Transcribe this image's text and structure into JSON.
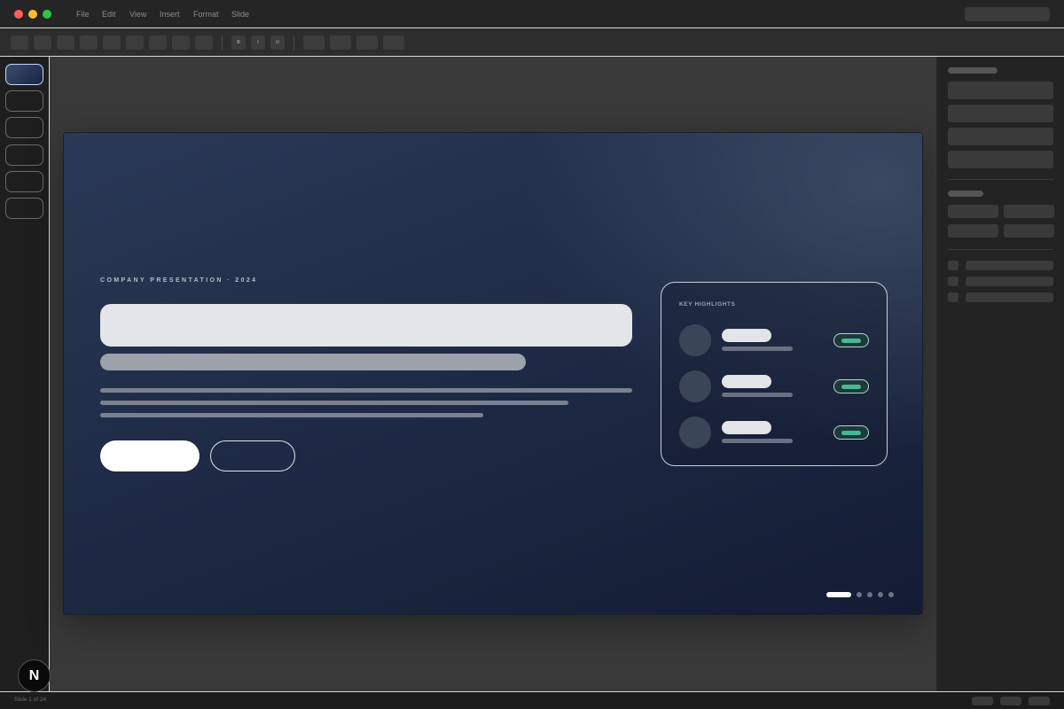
{
  "window": {
    "menu": [
      "File",
      "Edit",
      "View",
      "Insert",
      "Format",
      "Slide"
    ],
    "traffic_lights": {
      "close": "#ff5f57",
      "minimize": "#febc2e",
      "maximize": "#28c840"
    }
  },
  "toolbar": {
    "bold": "B",
    "italic": "I",
    "underline": "U"
  },
  "slide": {
    "eyebrow": "COMPANY PRESENTATION · 2024",
    "highlights_title": "KEY HIGHLIGHTS",
    "accent_color": "#49b796",
    "pagination": {
      "total": 5,
      "active": 1
    }
  },
  "status": {
    "slide_counter": "Slide 1 of 24"
  },
  "badge": {
    "icon": "next-logo-icon",
    "glyph": "N"
  }
}
